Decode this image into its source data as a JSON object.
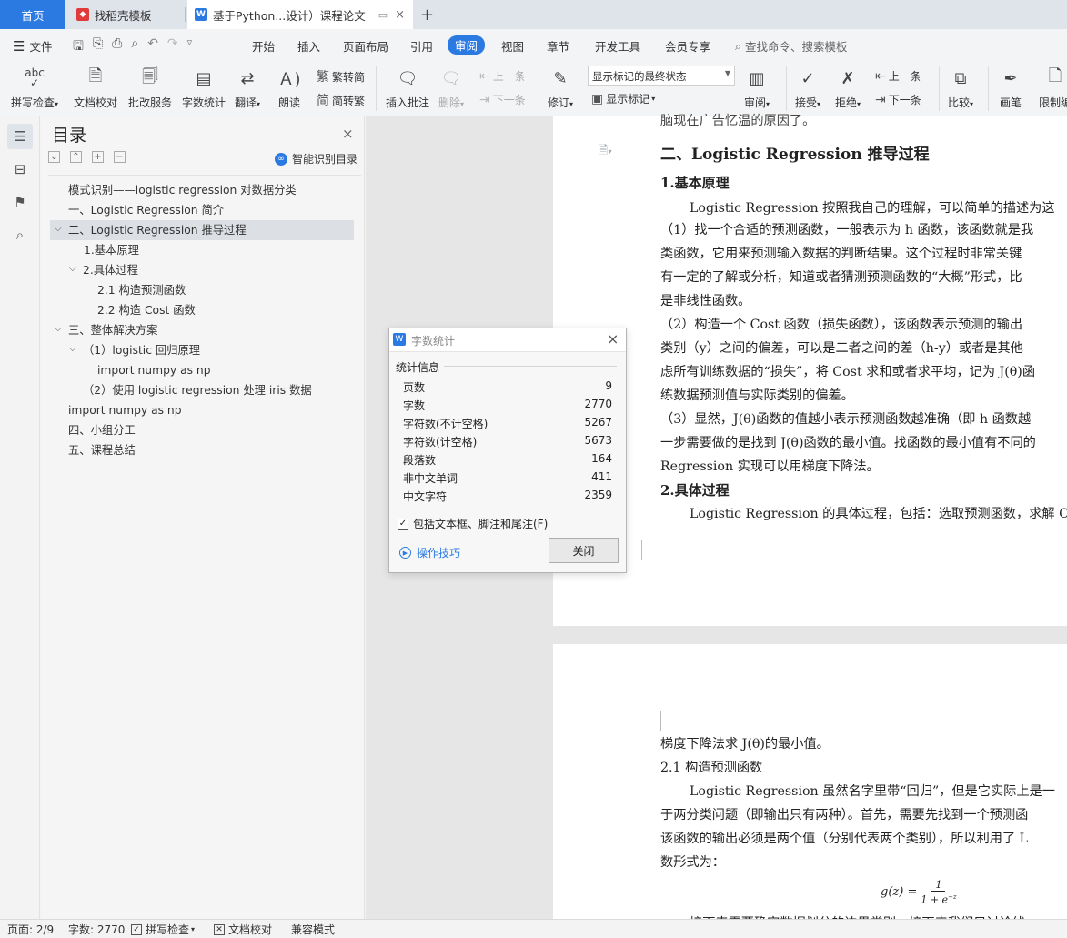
{
  "tabs": {
    "home": "首页",
    "template": "找稻壳模板",
    "doc": "基于Python...设计）课程论文",
    "add": "+"
  },
  "menu": {
    "file": "文件",
    "items": [
      "开始",
      "插入",
      "页面布局",
      "引用",
      "审阅",
      "视图",
      "章节",
      "开发工具",
      "会员专享"
    ],
    "search": "查找命令、搜索模板"
  },
  "toolbar": {
    "spellcheck": "拼写检查",
    "doc_check": "文档校对",
    "batch_service": "批改服务",
    "word_count": "字数统计",
    "translate": "翻译",
    "read_aloud": "朗读",
    "to_traditional": "繁转简",
    "to_simplified": "简转繁",
    "insert_comment": "插入批注",
    "delete": "删除",
    "prev_comment": "上一条",
    "next_comment": "下一条",
    "revise": "修订",
    "markup_mode": "显示标记的最终状态",
    "show_markup": "显示标记",
    "review": "审阅",
    "accept": "接受",
    "reject": "拒绝",
    "prev_change": "上一条",
    "next_change": "下一条",
    "compare": "比较",
    "pen": "画笔",
    "restrict": "限制编"
  },
  "toc": {
    "title": "目录",
    "smart": "智能识别目录",
    "items": [
      "模式识别——logistic regression 对数据分类",
      "一、Logistic Regression 简介",
      "二、Logistic Regression 推导过程",
      "1.基本原理",
      "2.具体过程",
      "2.1 构造预测函数",
      "2.2 构造 Cost 函数",
      "三、整体解决方案",
      "（1）logistic 回归原理",
      "import numpy as np",
      "（2）使用 logistic regression 处理 iris 数据",
      "import numpy as np",
      "四、小组分工",
      "五、课程总结"
    ]
  },
  "doc": {
    "top_cut": "脑现在广告忆温的原因了。",
    "heading2": "二、Logistic Regression 推导过程",
    "sub1": "1.基本原理",
    "p1": "Logistic Regression 按照我自己的理解，可以简单的描述为这",
    "p2": "（1）找一个合适的预测函数，一般表示为 h 函数，该函数就是我",
    "p3": "类函数，它用来预测输入数据的判断结果。这个过程时非常关键",
    "p4": "有一定的了解或分析，知道或者猜测预测函数的“大概”形式，比",
    "p5": "是非线性函数。",
    "p6": "（2）构造一个 Cost 函数（损失函数），该函数表示预测的输出",
    "p7": "类别（y）之间的偏差，可以是二者之间的差（h-y）或者是其他",
    "p8": "虑所有训练数据的“损失”，将 Cost 求和或者求平均，记为 J(θ)函",
    "p9": "练数据预测值与实际类别的偏差。",
    "p10": "（3）显然，J(θ)函数的值越小表示预测函数越准确（即 h 函数越",
    "p11": "一步需要做的是找到 J(θ)函数的最小值。找函数的最小值有不同的",
    "p12": "Regression 实现可以用梯度下降法。",
    "sub2": "2.具体过程",
    "p13": "Logistic Regression 的具体过程，包括：选取预测函数，求解 C",
    "q1": "梯度下降法求 J(θ)的最小值。",
    "q2": "2.1 构造预测函数",
    "q3": "Logistic Regression 虽然名字里带“回归”，但是它实际上是一",
    "q4": "于两分类问题（即输出只有两种）。首先，需要先找到一个预测函",
    "q5": "该函数的输出必须是两个值（分别代表两个类别），所以利用了 L",
    "q6": "数形式为：",
    "formula_lhs": "g(z) =",
    "formula_num": "1",
    "formula_den": "1 + e",
    "formula_exp": "−z",
    "q7": "接下来需要确定数据划分的边界类别，接下来我们只讨论线"
  },
  "dialog": {
    "title": "字数统计",
    "section": "统计信息",
    "rows": [
      {
        "label": "页数",
        "value": "9"
      },
      {
        "label": "字数",
        "value": "2770"
      },
      {
        "label": "字符数(不计空格)",
        "value": "5267"
      },
      {
        "label": "字符数(计空格)",
        "value": "5673"
      },
      {
        "label": "段落数",
        "value": "164"
      },
      {
        "label": "非中文单词",
        "value": "411"
      },
      {
        "label": "中文字符",
        "value": "2359"
      }
    ],
    "checkbox_label": "包括文本框、脚注和尾注(F)",
    "tips": "操作技巧",
    "close": "关闭"
  },
  "status": {
    "page": "页面: 2/9",
    "words": "字数: 2770",
    "spell": "拼写检查",
    "doccheck": "文档校对",
    "compat": "兼容模式"
  },
  "colors": {
    "accent": "#2a7ae2",
    "brand_red": "#e03a3a"
  }
}
